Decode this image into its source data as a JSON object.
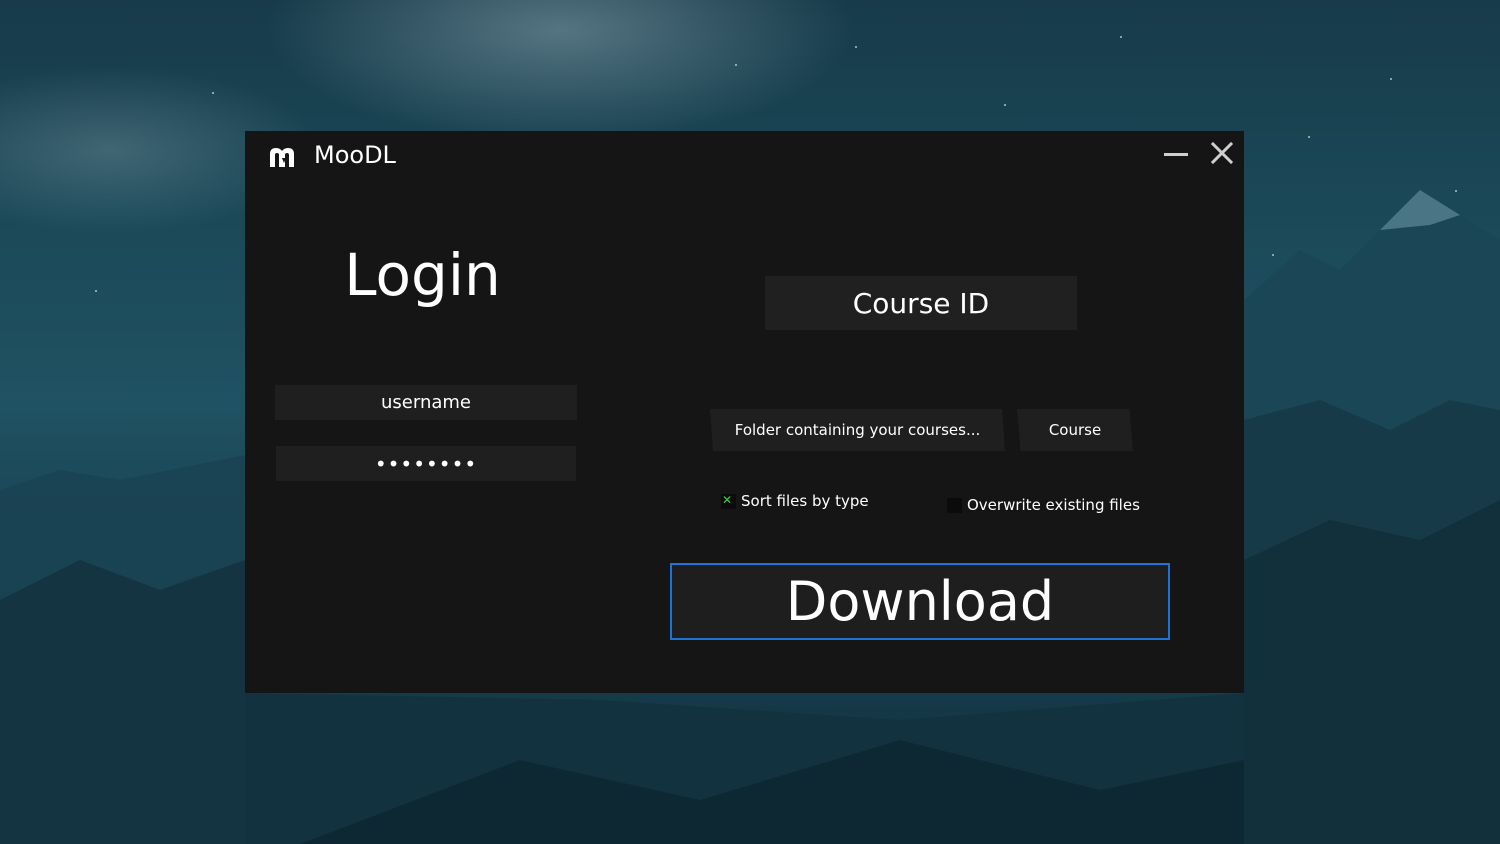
{
  "window": {
    "title": "MooDL",
    "logo_icon": "moodl-logo-icon",
    "minimize_icon": "minimize-icon",
    "close_icon": "close-icon"
  },
  "login": {
    "heading": "Login",
    "username_value": "username",
    "password_value": "••••••••"
  },
  "course": {
    "course_id_value": "Course ID",
    "folder_button_label": "Folder containing your courses...",
    "course_button_label": "Course"
  },
  "options": {
    "sort_by_type_label": "Sort files by type",
    "sort_by_type_checked": true,
    "overwrite_label": "Overwrite existing files",
    "overwrite_checked": false
  },
  "actions": {
    "download_label": "Download"
  },
  "colors": {
    "window_bg": "#151515",
    "field_bg": "#1f1f1f",
    "accent_border": "#1e73d8",
    "check_green": "#3ad14c"
  }
}
